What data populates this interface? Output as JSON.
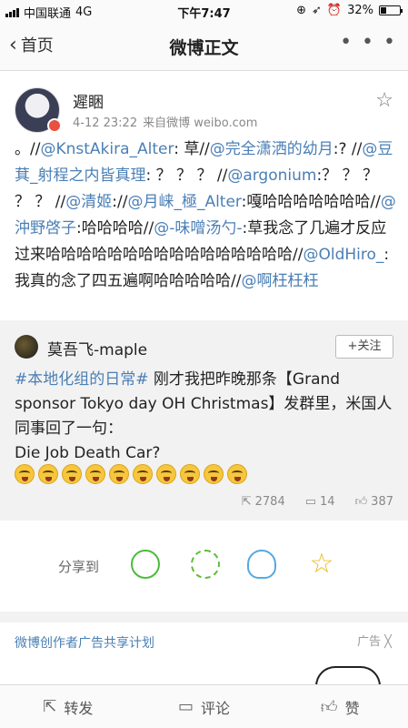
{
  "status_bar": {
    "carrier": "中国联通",
    "network": "4G",
    "time": "下午7:47",
    "battery": "32%",
    "battery_level": 0.32
  },
  "nav": {
    "back_label": "首页",
    "title": "微博正文",
    "more": "• • •"
  },
  "post": {
    "author": "遲睏",
    "time": "4-12 23:22",
    "source": "来自微博 weibo.com",
    "segments": [
      {
        "t": "。//",
        "m": false
      },
      {
        "t": "@KnstAkira_Alter",
        "m": true
      },
      {
        "t": ": 草//",
        "m": false
      },
      {
        "t": "@完全潇洒的幼月",
        "m": true
      },
      {
        "t": ":? //",
        "m": false
      },
      {
        "t": "@豆萁_射程之内皆真理",
        "m": true
      },
      {
        "t": ": ？ ？ ？ //",
        "m": false
      },
      {
        "t": "@argonium",
        "m": true
      },
      {
        "t": ":？ ？ ？ ？ ？ //",
        "m": false
      },
      {
        "t": "@清姬",
        "m": true
      },
      {
        "t": "://",
        "m": false
      },
      {
        "t": "@月崃_極_Alter",
        "m": true
      },
      {
        "t": ":嘎哈哈哈哈哈哈哈//",
        "m": false
      },
      {
        "t": "@沖野啓子",
        "m": true
      },
      {
        "t": ":哈哈哈哈//",
        "m": false
      },
      {
        "t": "@-味噌汤勺-",
        "m": true
      },
      {
        "t": ":草我念了几遍才反应过来哈哈哈哈哈哈哈哈哈哈哈哈哈哈哈哈//",
        "m": false
      },
      {
        "t": "@OldHiro_",
        "m": true
      },
      {
        "t": ":我真的念了四五遍啊哈哈哈哈哈//",
        "m": false
      },
      {
        "t": "@啊枉枉枉",
        "m": true
      }
    ]
  },
  "repost": {
    "author": "莫吾飞-maple",
    "follow_label": "+关注",
    "tag": "#本地化组的日常#",
    "text": " 刚才我把昨晚那条【Grand sponsor Tokyo day OH Christmas】发群里，米国人同事回了一句：",
    "text2": "Die Job Death Car?",
    "emoji_count": 10,
    "reposts": "2784",
    "comments": "14",
    "likes": "387"
  },
  "share": {
    "label": "分享到",
    "icons": [
      "wechat-icon",
      "moments-icon",
      "qq-icon",
      "qzone-icon"
    ]
  },
  "ad": {
    "label": "微博创作者广告共享计划",
    "tag": "广告 ╳"
  },
  "bottom_bar": {
    "repost": "转发",
    "comment": "评论",
    "like": "赞"
  },
  "colors": {
    "mention": "#4a7fb5",
    "card_bg": "#f2f2f2",
    "badge": "#e8503f"
  }
}
